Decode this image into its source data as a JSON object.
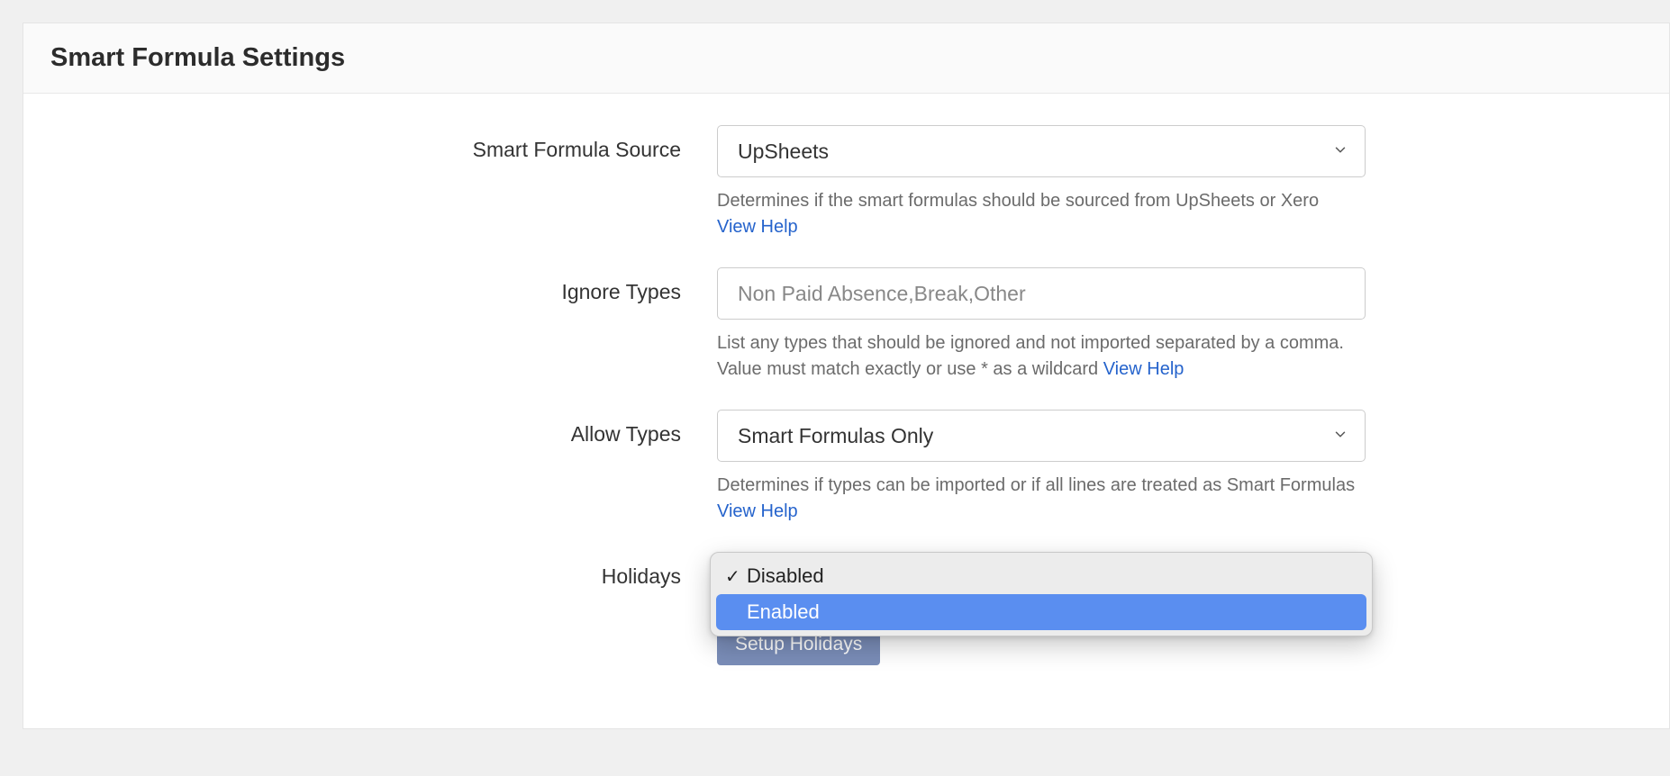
{
  "panel": {
    "title": "Smart Formula Settings"
  },
  "source": {
    "label": "Smart Formula Source",
    "value": "UpSheets",
    "help": "Determines if the smart formulas should be sourced from UpSheets or Xero",
    "help_link": "View Help"
  },
  "ignore": {
    "label": "Ignore Types",
    "placeholder": "Non Paid Absence,Break,Other",
    "help": "List any types that should be ignored and not imported separated by a comma. Value must match exactly or use * as a wildcard ",
    "help_link": "View Help"
  },
  "allow": {
    "label": "Allow Types",
    "value": "Smart Formulas Only",
    "help": "Determines if types can be imported or if all lines are treated as Smart Formulas ",
    "help_link": "View Help"
  },
  "holidays": {
    "label": "Holidays",
    "options": {
      "disabled": "Disabled",
      "enabled": "Enabled"
    },
    "check": "✓",
    "setup_button": "Setup Holidays"
  }
}
